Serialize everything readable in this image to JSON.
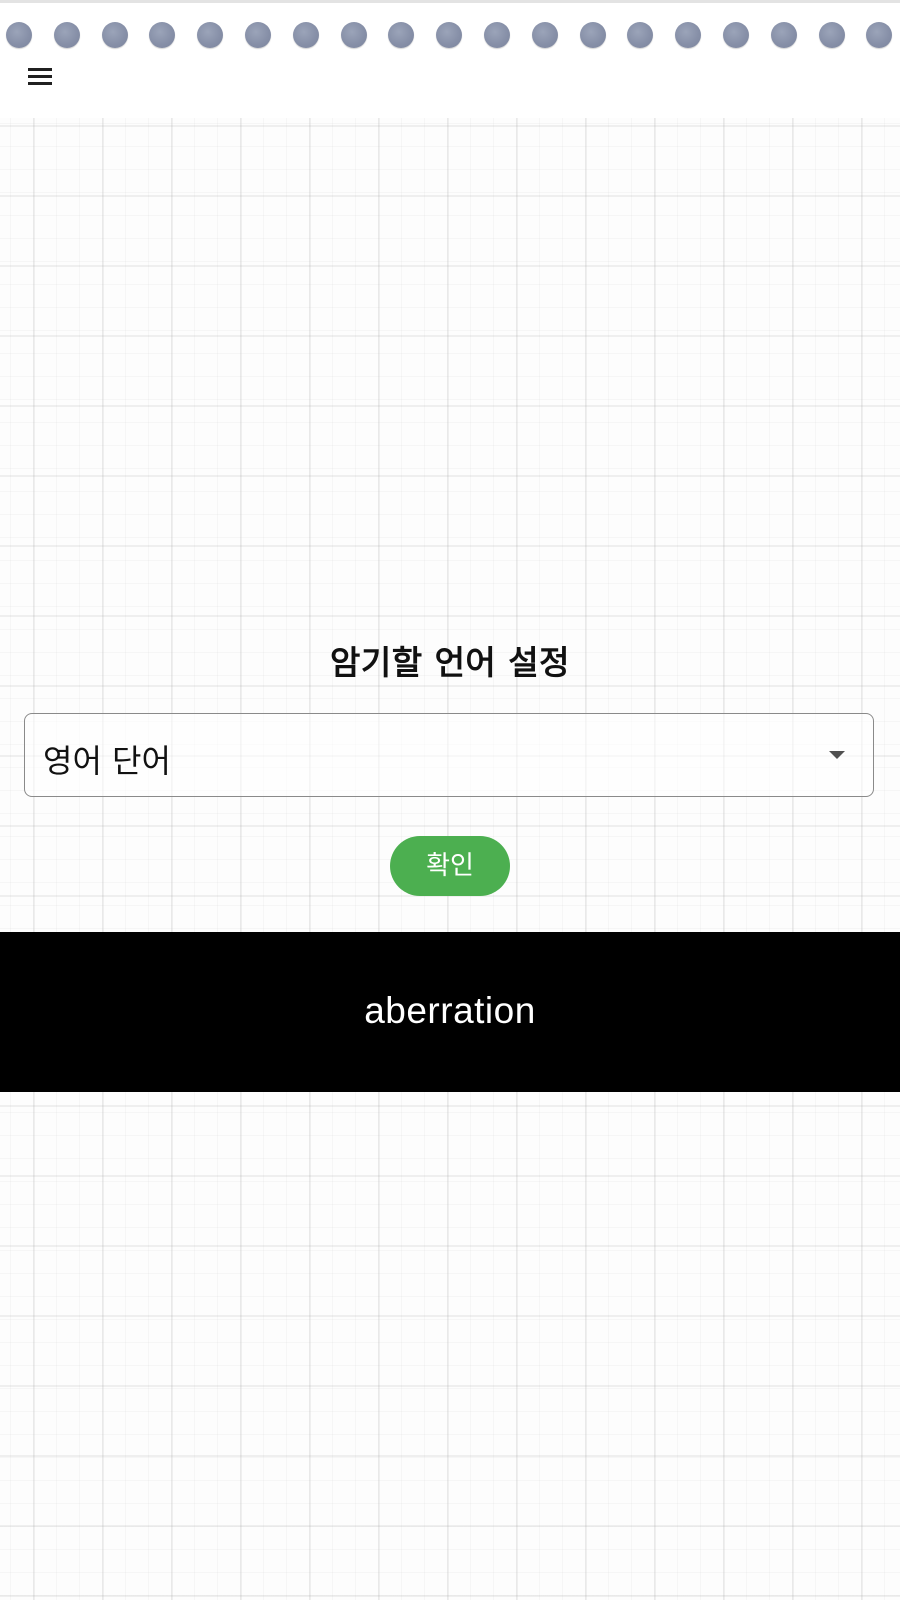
{
  "header": {
    "menu_icon": "hamburger-menu-icon",
    "ring_count": 19,
    "ring_color": "#8a93aa"
  },
  "settings": {
    "title": "암기할 언어 설정",
    "language_select": {
      "selected": "영어 단어",
      "arrow_icon": "dropdown-arrow-icon"
    },
    "confirm_label": "확인",
    "confirm_color": "#4caf50"
  },
  "word_banner": {
    "word": "aberration",
    "background": "#000000",
    "text_color": "#ffffff"
  }
}
